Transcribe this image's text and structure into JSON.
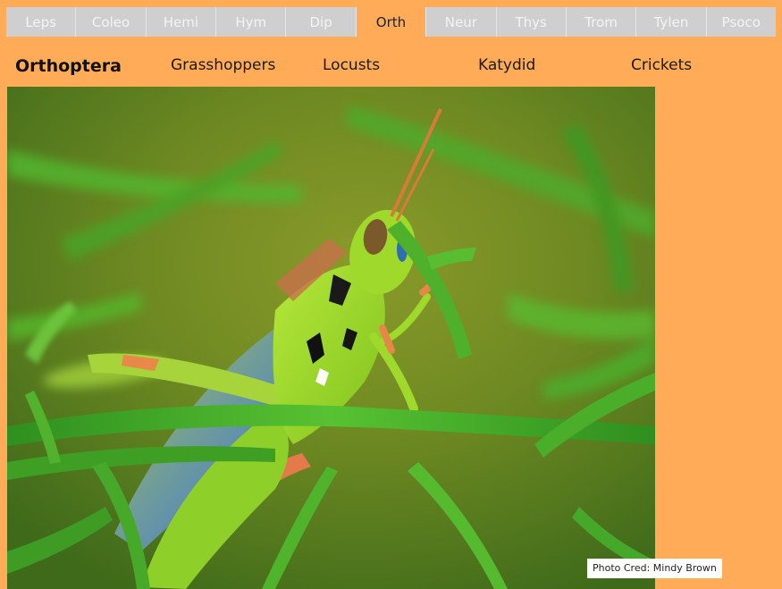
{
  "tabs": [
    {
      "label": "Leps",
      "active": false
    },
    {
      "label": "Coleo",
      "active": false
    },
    {
      "label": "Hemi",
      "active": false
    },
    {
      "label": "Hym",
      "active": false
    },
    {
      "label": "Dip",
      "active": false
    },
    {
      "label": "Orth",
      "active": true
    },
    {
      "label": "Neur",
      "active": false
    },
    {
      "label": "Thys",
      "active": false
    },
    {
      "label": "Trom",
      "active": false
    },
    {
      "label": "Tylen",
      "active": false
    },
    {
      "label": "Psoco",
      "active": false
    }
  ],
  "subnav": {
    "heading": "Orthoptera",
    "links": [
      "Grasshoppers",
      "Locusts",
      "Katydid",
      "Crickets"
    ]
  },
  "photo": {
    "credit": "Photo Cred: Mindy Brown"
  },
  "colors": {
    "page_background": "#ffab57",
    "tab_background": "#cfcfcf",
    "tab_text": "#f4f4f4",
    "active_tab_text": "#222222"
  }
}
